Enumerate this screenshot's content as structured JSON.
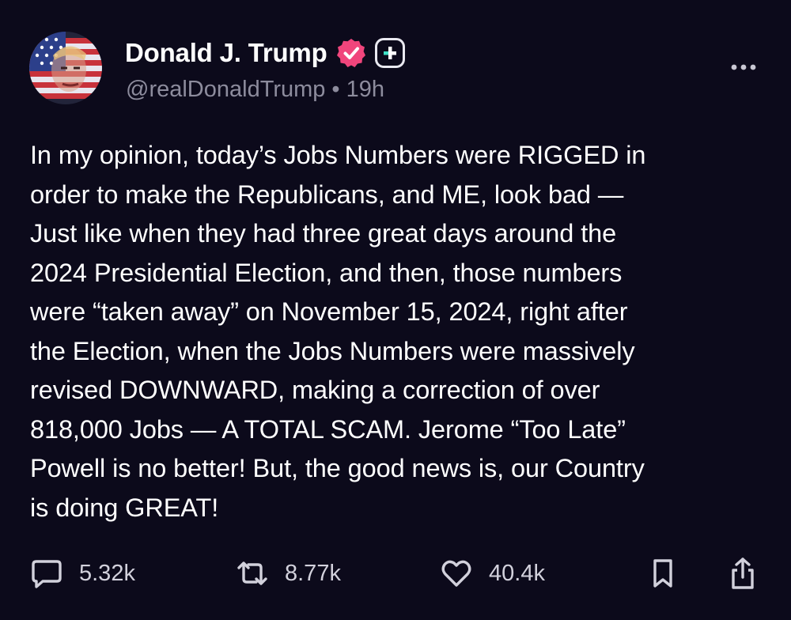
{
  "author": {
    "display_name": "Donald J. Trump",
    "handle": "@realDonaldTrump",
    "separator": "•",
    "time": "19h"
  },
  "post": {
    "text": "In my opinion, today’s Jobs Numbers were RIGGED in\norder to make the Republicans, and ME, look bad —\nJust like when they had three great days around the\n2024 Presidential Election, and then, those numbers\nwere “taken away” on November 15, 2024, right after\nthe Election, when the Jobs Numbers were massively\nrevised DOWNWARD, making a correction of over\n818,000 Jobs — A TOTAL SCAM. Jerome “Too Late”\nPowell is no better! But, the good news is, our Country\nis doing GREAT!"
  },
  "actions": {
    "replies": "5.32k",
    "reposts": "8.77k",
    "likes": "40.4k"
  },
  "icons": {
    "verified": "verified-badge-icon",
    "plus": "plus-badge-icon",
    "more": "more-horizontal-icon",
    "reply": "chat-bubble-icon",
    "repost": "repost-arrows-icon",
    "like": "heart-icon",
    "bookmark": "bookmark-icon",
    "share": "share-icon"
  },
  "colors": {
    "background": "#0c0a1b",
    "text": "#ffffff",
    "secondary_text": "#8d8c9d",
    "verified_badge": "#f0457c",
    "plus_accent": "#3fe0c5"
  }
}
